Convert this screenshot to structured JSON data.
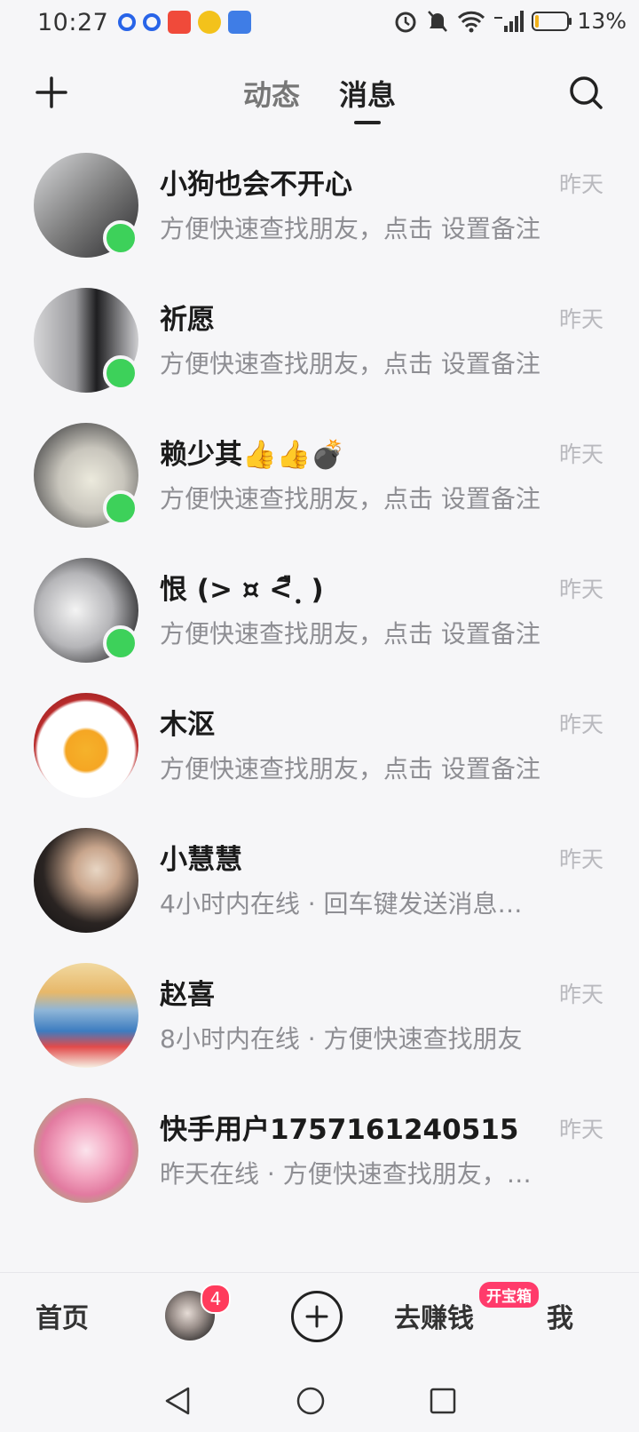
{
  "status_bar": {
    "time": "10:27",
    "battery_text": "13%",
    "battery_level": 0.13
  },
  "header": {
    "tabs": [
      {
        "label": "动态",
        "active": false
      },
      {
        "label": "消息",
        "active": true
      }
    ]
  },
  "conversations": [
    {
      "name": "小狗也会不开心",
      "time": "昨天",
      "preview": "方便快速查找朋友，点击 设置备注",
      "online": true
    },
    {
      "name": "祈愿",
      "time": "昨天",
      "preview": "方便快速查找朋友，点击 设置备注",
      "online": true
    },
    {
      "name": "赖少其👍👍💣",
      "time": "昨天",
      "preview": "方便快速查找朋友，点击 设置备注",
      "online": true
    },
    {
      "name": "恨 (> ¤ <ื ฺ )",
      "time": "昨天",
      "preview": "方便快速查找朋友，点击 设置备注",
      "online": true
    },
    {
      "name": "木沤",
      "time": "昨天",
      "preview": "方便快速查找朋友，点击 设置备注",
      "online": false
    },
    {
      "name": "小慧慧",
      "time": "昨天",
      "preview": "4小时内在线 · 回车键发送消息…",
      "online": false
    },
    {
      "name": "赵喜",
      "time": "昨天",
      "preview": "8小时内在线 · 方便快速查找朋友",
      "online": false
    },
    {
      "name": "快手用户1757161240515",
      "time": "昨天",
      "preview": "昨天在线 · 方便快速查找朋友，…",
      "online": false
    }
  ],
  "bottom_nav": {
    "home": "首页",
    "badge": "4",
    "earn": "去赚钱",
    "chest": "开宝箱",
    "me": "我"
  },
  "colors": {
    "online": "#3dd15a",
    "badge": "#ff3b5c",
    "background": "#f6f6f8"
  }
}
